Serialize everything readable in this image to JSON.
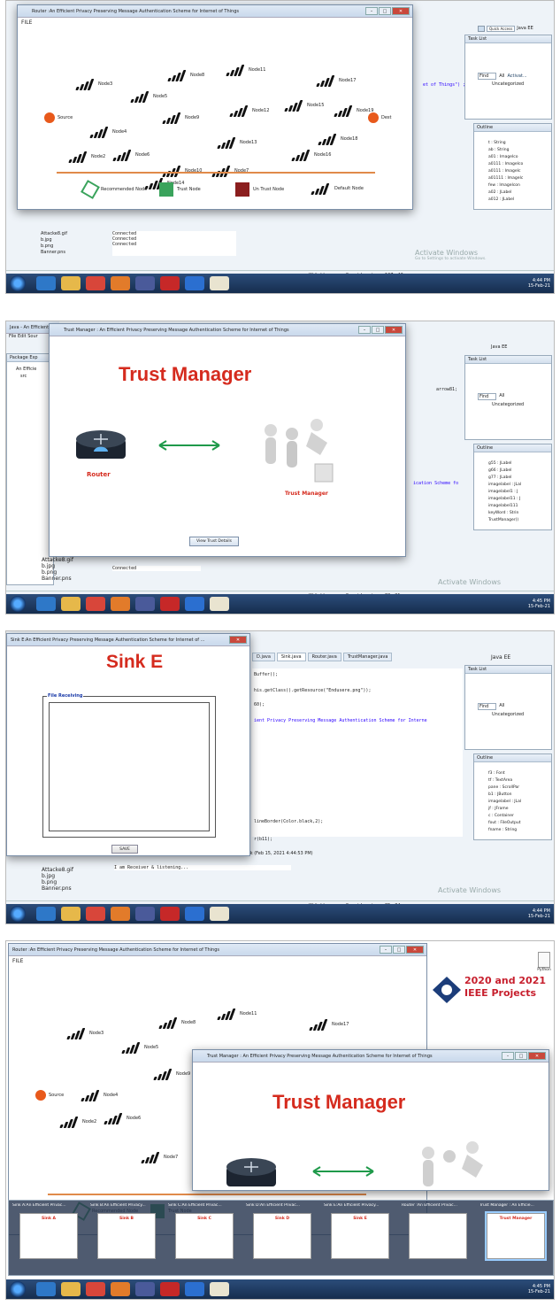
{
  "shot1": {
    "router_title": "Router :An Efficient Privacy Preserving Message Authentication Scheme for Internet of Things",
    "menu_file": "FILE",
    "source_label": "Source",
    "dest_label": "Dest",
    "nodes": [
      {
        "label": "Node3"
      },
      {
        "label": "Node8"
      },
      {
        "label": "Node11"
      },
      {
        "label": "Node17"
      },
      {
        "label": "Node5"
      },
      {
        "label": "Node15"
      },
      {
        "label": "Node12"
      },
      {
        "label": "Node19"
      },
      {
        "label": "Node9"
      },
      {
        "label": "Node4"
      },
      {
        "label": "Node18"
      },
      {
        "label": "Node13"
      },
      {
        "label": "Node2"
      },
      {
        "label": "Node6"
      },
      {
        "label": "Node16"
      },
      {
        "label": "Node10"
      },
      {
        "label": "Node7"
      },
      {
        "label": "Node14"
      }
    ],
    "legend": {
      "recommended": "Recommended Node",
      "trust": "Trust Node",
      "untrust": "Un Trust Node",
      "default": "Default Node"
    },
    "package_files": [
      "Attacke8.gif",
      "b.jpg",
      "b.png",
      "Banner.pns"
    ],
    "console_lines": [
      "Connected",
      "Connected",
      "Connected"
    ],
    "status": {
      "writable": "Writable",
      "insert": "Smart Insert",
      "pos": "127 : 42"
    },
    "activate": "Activate Windows",
    "activate_sub": "Go to Settings to activate Windows.",
    "clock": "4:44 PM",
    "date": "15-Feb-21",
    "task_list": "Task List",
    "outline": "Outline",
    "find": "Find",
    "all": "All",
    "activate_link": "Activat...",
    "uncategorized": "Uncategorized",
    "java_ee": "Java EE",
    "quick_access": "Quick Access",
    "code_fragment": "et of Things\") ;",
    "outline_items": [
      "t : String",
      "ab : String",
      "a01 : ImageIco",
      "a0111 : ImageIco",
      "a0111 : ImageIc",
      "a01111 : ImageIc",
      "few : ImageIcon",
      "a02 : JLabel",
      "a012 : JLabel"
    ]
  },
  "shot2": {
    "ide_title": "Java - An Efficient",
    "menu": "File  Edit  Sour",
    "tm_title": "Trust Manager : An Efficient Privacy Preserving Message Authentication Scheme for Internet of Things",
    "heading": "Trust Manager",
    "router_caption": "Router",
    "manager_caption": "Trust Manager",
    "button": "View Trust Details",
    "package_explorer": "Package Exp",
    "proj": "An Efficie",
    "src": "src",
    "console_line": "Connected",
    "package_files": [
      "Attacke8.gif",
      "b.jpg",
      "b.png",
      "Banner.pns"
    ],
    "status": {
      "writable": "Writable",
      "insert": "Smart Insert",
      "pos": "80 : 21"
    },
    "clock": "4:45 PM",
    "date": "15-Feb-21",
    "code_fragment": "arrow81;",
    "code_fragment2": "ication Scheme fo",
    "outline_items": [
      "g55 : JLabel",
      "g66 : JLabel",
      "g77 : JLabel",
      "imagelabel : JLal",
      "imagelabel1 : J",
      "imagelabel11 : J",
      "imagelabel111",
      "keyWord : Strin",
      "TrustManager()"
    ]
  },
  "shot3": {
    "title": "Sink E:An Efficient Privacy Preserving Message Authentication Scheme for Internet of ...",
    "heading": "Sink E",
    "group_title": "File Receiving",
    "save": "SAVE",
    "tabs": [
      "D.java",
      "Sink.java",
      "Router.java",
      "TrustManager.java"
    ],
    "code_lines": [
      "Buffer();",
      "his.getClass().getResource(\"Endusere.png\"));",
      "60);",
      "ient Privacy Preserving Message Authentication Scheme for Interne",
      "lineBorder(Color.black,2);",
      "r(b11);"
    ],
    "console_header": "Sink (Feb 15, 2021 4:44:53 PM)",
    "console_line": "I am Receiver & listening...",
    "package_files": [
      "Attacke8.gif",
      "b.jpg",
      "b.png",
      "Banner.pns"
    ],
    "status": {
      "writable": "Writable",
      "insert": "Smart Insert",
      "pos": "85 : 34"
    },
    "clock": "4:44 PM",
    "date": "15-Feb-21",
    "outline_items": [
      "f3 : Font",
      "tf : TextArea",
      "pane : ScrollPar",
      "b1 : JButton",
      "imagelabel : JLal",
      "jf : JFrame",
      "c : Container",
      "fout : FileOutput",
      "fname : String"
    ]
  },
  "shot4": {
    "router_title": "Router :An Efficient Privacy Preserving Message Authentication Scheme for Internet of Things",
    "tm_title": "Trust Manager : An Efficient Privacy Preserving Message Authentication Scheme for Internet of Things",
    "heading": "Trust Manager",
    "menu_file": "FILE",
    "source_label": "Source",
    "nodes": [
      {
        "label": "Node3"
      },
      {
        "label": "Node8"
      },
      {
        "label": "Node11"
      },
      {
        "label": "Node17"
      },
      {
        "label": "Node5"
      },
      {
        "label": "Node9"
      },
      {
        "label": "Node4"
      },
      {
        "label": "Node2"
      },
      {
        "label": "Node6"
      },
      {
        "label": "Node7"
      }
    ],
    "legend": {
      "recommended": "Recommended Node",
      "trust": "Trust Node"
    },
    "ieee_line1": "2020 and 2021",
    "ieee_line2": "IEEE Projects",
    "desktop_icon": "Python",
    "switcher": [
      {
        "label": "Sink A:An Efficient Privac...",
        "thumb": "Sink A"
      },
      {
        "label": "Sink B:An Efficient Privacy...",
        "thumb": "Sink B"
      },
      {
        "label": "Sink C:An Efficient Privac...",
        "thumb": "Sink C"
      },
      {
        "label": "Sink D:An Efficient Privac...",
        "thumb": "Sink D"
      },
      {
        "label": "Sink E:An Efficient Privacy...",
        "thumb": "Sink E"
      },
      {
        "label": "Router :An Efficient Privac...",
        "thumb": ""
      },
      {
        "label": "Trust Manager : An Efficie...",
        "thumb": "Trust Manager"
      }
    ],
    "clock": "4:45 PM",
    "date": "15-Feb-21"
  },
  "colors": {
    "trust_green": "#3aa35c",
    "title_red": "#d52b1e",
    "orange": "#e8591b",
    "taskbar": "#1f3b63"
  }
}
